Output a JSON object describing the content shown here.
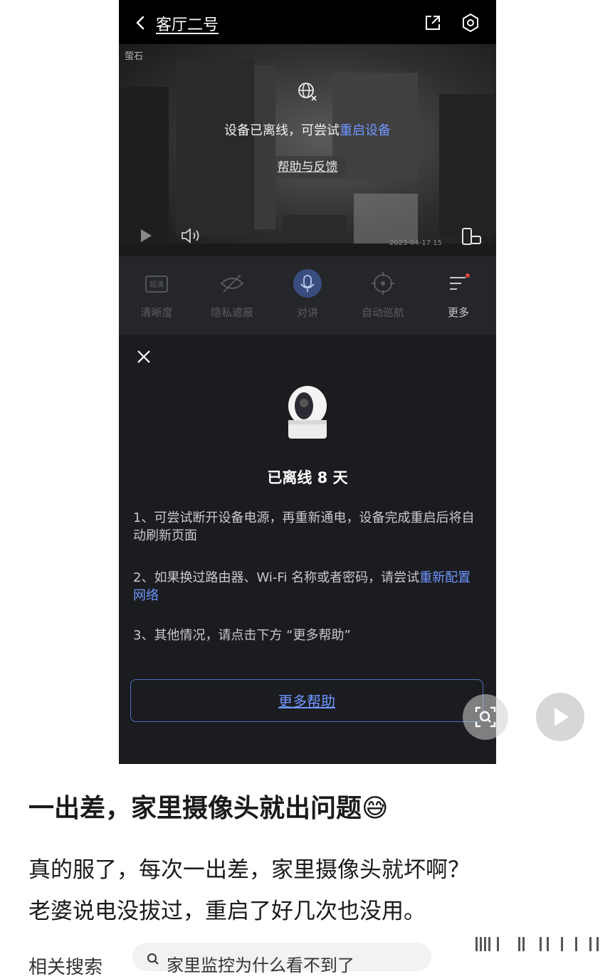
{
  "app": {
    "title": "客厅二号",
    "brand": "萤石"
  },
  "video": {
    "offline_text": "设备已离线，可尝试",
    "offline_link": "重启设备",
    "help_button": "帮助与反馈",
    "timestamp": "2023-04-17 15"
  },
  "controls": [
    {
      "label": "清晰度",
      "icon_text": "超清",
      "icon": "hd-icon"
    },
    {
      "label": "隐私遮蔽",
      "icon": "eye-off-icon"
    },
    {
      "label": "对讲",
      "icon": "mic-icon"
    },
    {
      "label": "自动巡航",
      "icon": "crosshair-icon"
    },
    {
      "label": "更多",
      "icon": "more-icon"
    }
  ],
  "sheet": {
    "offline_days": "已离线 8 天",
    "tip1": "1、可尝试断开设备电源，再重新通电，设备完成重启后将自动刷新页面",
    "tip2_text": "2、如果换过路由器、Wi-Fi 名称或者密码，请尝试",
    "tip2_link": "重新配置网络",
    "tip3": "3、其他情况，请点击下方 “更多帮助”",
    "more_help": "更多帮助"
  },
  "post": {
    "title": "一出差，家里摄像头就出问题😅",
    "line1": "真的服了，每次一出差，家里摄像头就坏啊？",
    "line2": "老婆说电没拔过，重启了好几次也没用。",
    "related_label": "相关搜索",
    "related_query": "家里监控为什么看不到了"
  },
  "colors": {
    "accent": "#6f96ff",
    "phone_bg": "#1b1c1f",
    "red_dot": "#e0443d"
  }
}
